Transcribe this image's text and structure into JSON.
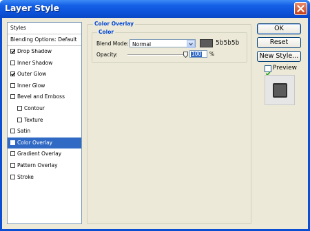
{
  "window": {
    "title": "Layer Style"
  },
  "styles_list": {
    "header": "Styles",
    "blending_options": "Blending Options: Default",
    "items": [
      {
        "label": "Drop Shadow",
        "checked": true,
        "indent": false,
        "selected": false
      },
      {
        "label": "Inner Shadow",
        "checked": false,
        "indent": false,
        "selected": false
      },
      {
        "label": "Outer Glow",
        "checked": true,
        "indent": false,
        "selected": false
      },
      {
        "label": "Inner Glow",
        "checked": false,
        "indent": false,
        "selected": false
      },
      {
        "label": "Bevel and Emboss",
        "checked": false,
        "indent": false,
        "selected": false
      },
      {
        "label": "Contour",
        "checked": false,
        "indent": true,
        "selected": false
      },
      {
        "label": "Texture",
        "checked": false,
        "indent": true,
        "selected": false
      },
      {
        "label": "Satin",
        "checked": false,
        "indent": false,
        "selected": false
      },
      {
        "label": "Color Overlay",
        "checked": true,
        "indent": false,
        "selected": true
      },
      {
        "label": "Gradient Overlay",
        "checked": false,
        "indent": false,
        "selected": false
      },
      {
        "label": "Pattern Overlay",
        "checked": false,
        "indent": false,
        "selected": false
      },
      {
        "label": "Stroke",
        "checked": false,
        "indent": false,
        "selected": false
      }
    ]
  },
  "color_overlay": {
    "group_title": "Color Overlay",
    "subgroup_title": "Color",
    "blend_mode_label": "Blend Mode:",
    "blend_mode_value": "Normal",
    "color_hex": "5b5b5b",
    "color_swatch": "#5b5b5b",
    "opacity_label": "Opacity:",
    "opacity_value": "100",
    "opacity_unit": "%",
    "opacity_fraction": 1.0
  },
  "buttons": {
    "ok": "OK",
    "reset": "Reset",
    "new_style": "New Style..."
  },
  "preview": {
    "label": "Preview",
    "checked": true,
    "fill": "#5b5b5b"
  },
  "colors": {
    "title_bar": "#0c52d9",
    "selection": "#316ac5",
    "group_title": "#0046d5"
  }
}
